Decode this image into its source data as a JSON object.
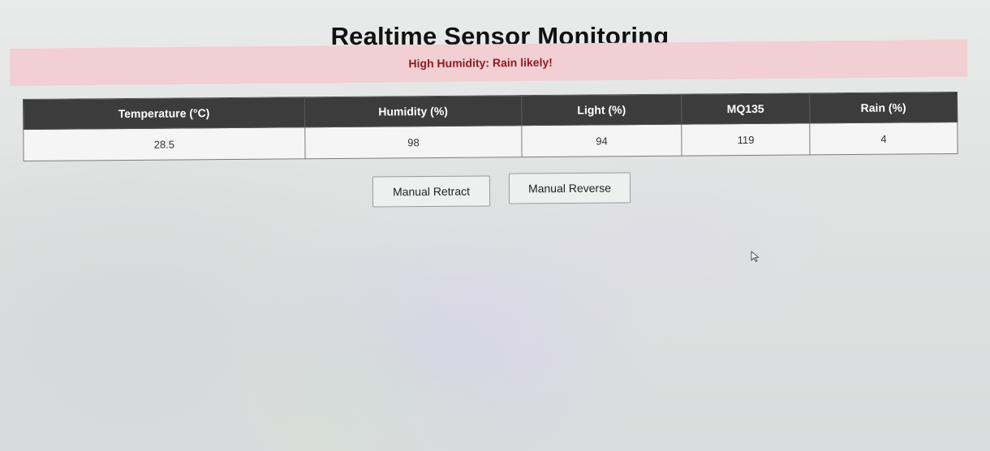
{
  "page": {
    "title": "Realtime Sensor Monitoring"
  },
  "alert": {
    "text": "High Humidity: Rain likely!",
    "background_color": "#f1cfd3",
    "text_color": "#8e1c22"
  },
  "sensor_table": {
    "headers": [
      "Temperature (°C)",
      "Humidity (%)",
      "Light (%)",
      "MQ135",
      "Rain (%)"
    ],
    "values": [
      "28.5",
      "98",
      "94",
      "119",
      "4"
    ],
    "header_background": "#3c3c3c"
  },
  "controls": {
    "retract_label": "Manual Retract",
    "reverse_label": "Manual Reverse"
  },
  "cursor": {
    "icon": "mouse-pointer-icon"
  }
}
